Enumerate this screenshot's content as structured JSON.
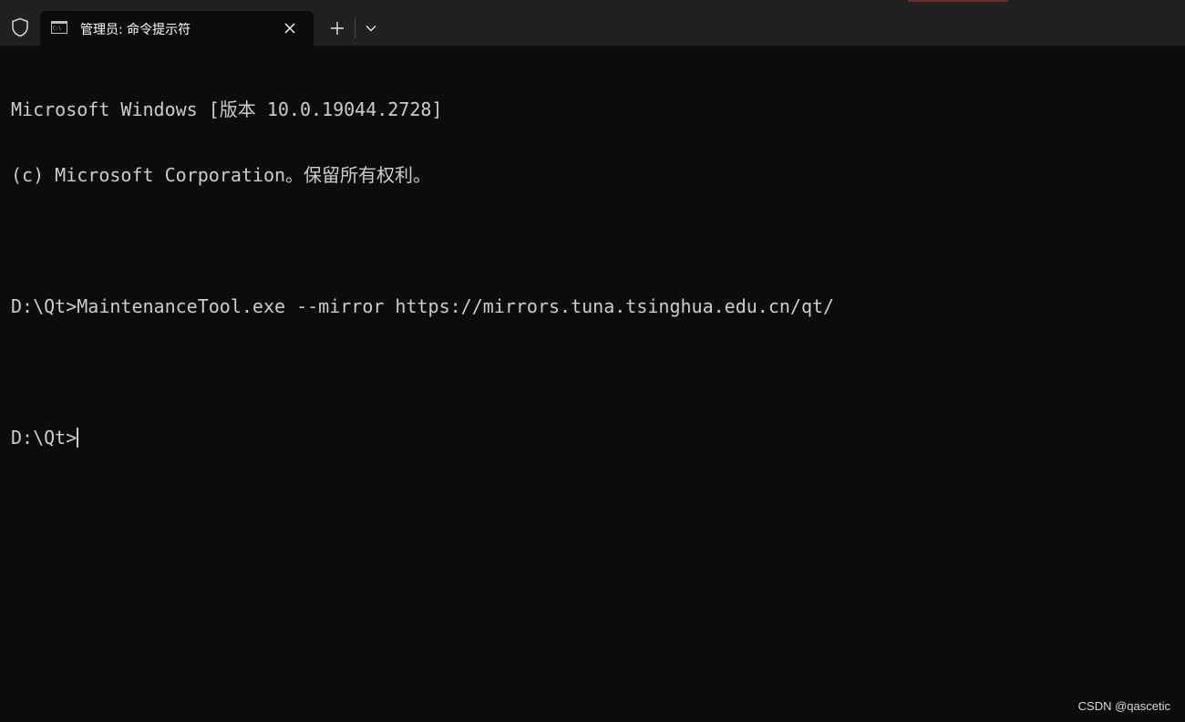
{
  "tab": {
    "icon": "cmd-icon",
    "title": "管理员: 命令提示符"
  },
  "tabbar": {
    "shield_icon": "shield-icon",
    "close_icon": "close-icon",
    "new_tab_icon": "plus-icon",
    "dropdown_icon": "chevron-down-icon"
  },
  "terminal": {
    "lines": [
      "Microsoft Windows [版本 10.0.19044.2728]",
      "(c) Microsoft Corporation。保留所有权利。",
      "",
      "D:\\Qt>MaintenanceTool.exe --mirror https://mirrors.tuna.tsinghua.edu.cn/qt/",
      "",
      "D:\\Qt>"
    ]
  },
  "watermark": "CSDN @qascetic",
  "colors": {
    "background": "#0c0c0c",
    "tabbar": "#202020",
    "text": "#cccccc"
  }
}
